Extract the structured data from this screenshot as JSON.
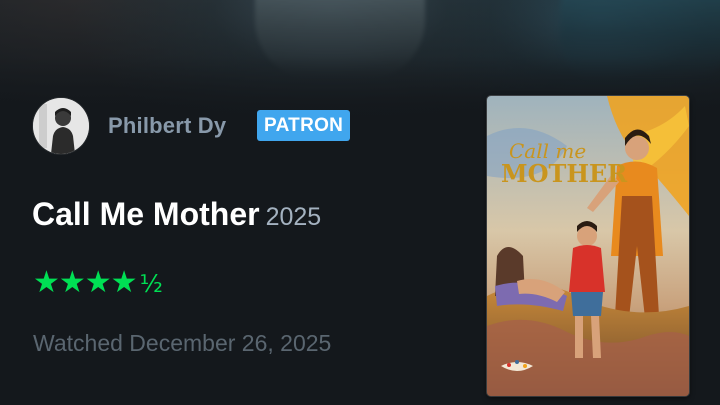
{
  "review": {
    "user_name": "Philbert Dy",
    "badge": "PATRON",
    "film_title": "Call Me Mother",
    "film_year": "2025",
    "rating": 4.5,
    "rating_stars": "★★★★",
    "rating_half": "½",
    "watched_text": "Watched December 26, 2025"
  },
  "poster": {
    "title_line1": "Call me",
    "title_line2": "MOTHER"
  },
  "colors": {
    "background": "#14181c",
    "username": "#8899aa",
    "badge_bg": "#40a6ee",
    "star_green": "#00e054",
    "year": "#a4b2c0",
    "watched": "#5a6670"
  }
}
